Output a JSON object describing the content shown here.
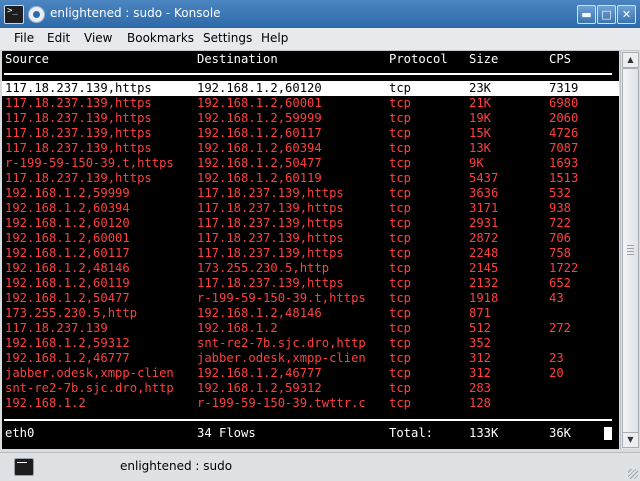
{
  "window": {
    "title": "enlightened : sudo - Konsole"
  },
  "menu": [
    "File",
    "Edit",
    "View",
    "Bookmarks",
    "Settings",
    "Help"
  ],
  "columns": [
    "Source",
    "Destination",
    "Protocol",
    "Size",
    "CPS"
  ],
  "rows": [
    [
      "117.18.237.139,https",
      "192.168.1.2,60120",
      "tcp",
      "23K",
      "7319"
    ],
    [
      "117.18.237.139,https",
      "192.168.1.2,60001",
      "tcp",
      "21K",
      "6980"
    ],
    [
      "117.18.237.139,https",
      "192.168.1.2,59999",
      "tcp",
      "19K",
      "2060"
    ],
    [
      "117.18.237.139,https",
      "192.168.1.2,60117",
      "tcp",
      "15K",
      "4726"
    ],
    [
      "117.18.237.139,https",
      "192.168.1.2,60394",
      "tcp",
      "13K",
      "7087"
    ],
    [
      "r-199-59-150-39.t,https",
      "192.168.1.2,50477",
      "tcp",
      "9K",
      "1693"
    ],
    [
      "117.18.237.139,https",
      "192.168.1.2,60119",
      "tcp",
      "5437",
      "1513"
    ],
    [
      "192.168.1.2,59999",
      "117.18.237.139,https",
      "tcp",
      "3636",
      "532"
    ],
    [
      "192.168.1.2,60394",
      "117.18.237.139,https",
      "tcp",
      "3171",
      "938"
    ],
    [
      "192.168.1.2,60120",
      "117.18.237.139,https",
      "tcp",
      "2931",
      "722"
    ],
    [
      "192.168.1.2,60001",
      "117.18.237.139,https",
      "tcp",
      "2872",
      "706"
    ],
    [
      "192.168.1.2,60117",
      "117.18.237.139,https",
      "tcp",
      "2248",
      "758"
    ],
    [
      "192.168.1.2,48146",
      "173.255.230.5,http",
      "tcp",
      "2145",
      "1722"
    ],
    [
      "192.168.1.2,60119",
      "117.18.237.139,https",
      "tcp",
      "2132",
      "652"
    ],
    [
      "192.168.1.2,50477",
      "r-199-59-150-39.t,https",
      "tcp",
      "1918",
      "43"
    ],
    [
      "173.255.230.5,http",
      "192.168.1.2,48146",
      "tcp",
      "871",
      ""
    ],
    [
      "117.18.237.139",
      "192.168.1.2",
      "tcp",
      "512",
      "272"
    ],
    [
      "192.168.1.2,59312",
      "snt-re2-7b.sjc.dro,http",
      "tcp",
      "352",
      ""
    ],
    [
      "192.168.1.2,46777",
      "jabber.odesk,xmpp-clien",
      "tcp",
      "312",
      "23"
    ],
    [
      "jabber.odesk,xmpp-clien",
      "192.168.1.2,46777",
      "tcp",
      "312",
      "20"
    ],
    [
      "snt-re2-7b.sjc.dro,http",
      "192.168.1.2,59312",
      "tcp",
      "283",
      ""
    ],
    [
      "192.168.1.2",
      "r-199-59-150-39.twttr.c",
      "tcp",
      "128",
      ""
    ]
  ],
  "selected_row": 0,
  "footer": {
    "iface": "eth0",
    "flows": "34 Flows",
    "total_label": "Total:",
    "total_size": "133K",
    "total_cps": "36K"
  },
  "taskbar": {
    "label": "enlightened : sudo"
  },
  "colors": {
    "row_text": "#ff4040",
    "header_text": "#ffffff",
    "terminal_bg": "#000000",
    "titlebar": "#2d6aa8"
  },
  "icons": [
    "terminal-icon",
    "window-menu-icon",
    "minimize-icon",
    "maximize-icon",
    "close-icon",
    "scroll-up-icon",
    "scroll-down-icon"
  ]
}
